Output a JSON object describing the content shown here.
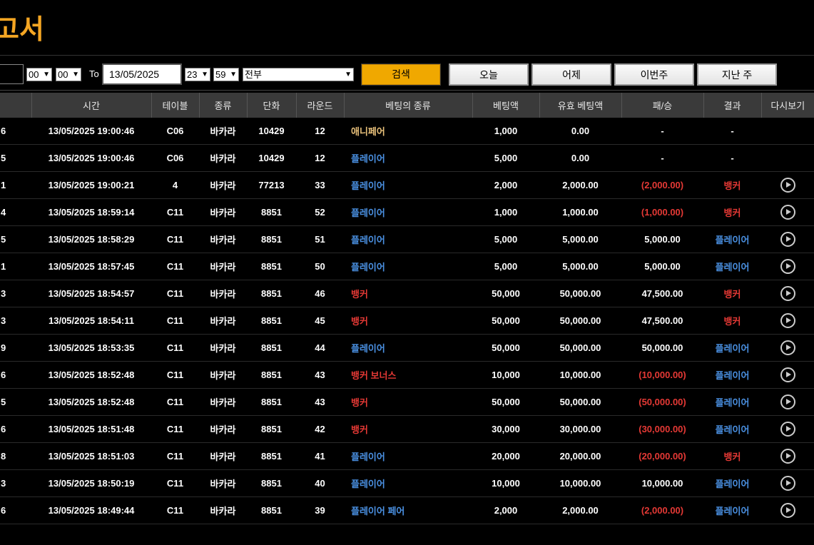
{
  "page_title": "고서",
  "filter": {
    "from_hour": "00",
    "from_minute": "00",
    "to_label": "To",
    "to_date": "13/05/2025",
    "to_hour": "23",
    "to_minute": "59",
    "category": "전부",
    "search_label": "검색",
    "quick": [
      "오늘",
      "어제",
      "이번주",
      "지난 주"
    ]
  },
  "table": {
    "columns": [
      "",
      "시간",
      "테이블",
      "종류",
      "단화",
      "라운드",
      "베팅의 종류",
      "베팅액",
      "유효 베팅액",
      "패/승",
      "결과",
      "다시보기"
    ],
    "rows": [
      {
        "id": "6",
        "time": "13/05/2025 19:00:46",
        "table": "C06",
        "game": "바카라",
        "shoe": "10429",
        "round": "12",
        "bet_type": "애니페어",
        "bet_color": "neutral",
        "amount": "1,000",
        "valid": "0.00",
        "winloss": "-",
        "wl_color": "white",
        "result": "-",
        "res_color": "white",
        "replay": false
      },
      {
        "id": "5",
        "time": "13/05/2025 19:00:46",
        "table": "C06",
        "game": "바카라",
        "shoe": "10429",
        "round": "12",
        "bet_type": "플레이어",
        "bet_color": "blue",
        "amount": "5,000",
        "valid": "0.00",
        "winloss": "-",
        "wl_color": "white",
        "result": "-",
        "res_color": "white",
        "replay": false
      },
      {
        "id": "1",
        "time": "13/05/2025 19:00:21",
        "table": "4",
        "game": "바카라",
        "shoe": "77213",
        "round": "33",
        "bet_type": "플레이어",
        "bet_color": "blue",
        "amount": "2,000",
        "valid": "2,000.00",
        "winloss": "(2,000.00)",
        "wl_color": "red",
        "result": "뱅커",
        "res_color": "red",
        "replay": true
      },
      {
        "id": "4",
        "time": "13/05/2025 18:59:14",
        "table": "C11",
        "game": "바카라",
        "shoe": "8851",
        "round": "52",
        "bet_type": "플레이어",
        "bet_color": "blue",
        "amount": "1,000",
        "valid": "1,000.00",
        "winloss": "(1,000.00)",
        "wl_color": "red",
        "result": "뱅커",
        "res_color": "red",
        "replay": true
      },
      {
        "id": "5",
        "time": "13/05/2025 18:58:29",
        "table": "C11",
        "game": "바카라",
        "shoe": "8851",
        "round": "51",
        "bet_type": "플레이어",
        "bet_color": "blue",
        "amount": "5,000",
        "valid": "5,000.00",
        "winloss": "5,000.00",
        "wl_color": "white",
        "result": "플레이어",
        "res_color": "blue",
        "replay": true
      },
      {
        "id": "1",
        "time": "13/05/2025 18:57:45",
        "table": "C11",
        "game": "바카라",
        "shoe": "8851",
        "round": "50",
        "bet_type": "플레이어",
        "bet_color": "blue",
        "amount": "5,000",
        "valid": "5,000.00",
        "winloss": "5,000.00",
        "wl_color": "white",
        "result": "플레이어",
        "res_color": "blue",
        "replay": true
      },
      {
        "id": "3",
        "time": "13/05/2025 18:54:57",
        "table": "C11",
        "game": "바카라",
        "shoe": "8851",
        "round": "46",
        "bet_type": "뱅커",
        "bet_color": "red",
        "amount": "50,000",
        "valid": "50,000.00",
        "winloss": "47,500.00",
        "wl_color": "white",
        "result": "뱅커",
        "res_color": "red",
        "replay": true
      },
      {
        "id": "3",
        "time": "13/05/2025 18:54:11",
        "table": "C11",
        "game": "바카라",
        "shoe": "8851",
        "round": "45",
        "bet_type": "뱅커",
        "bet_color": "red",
        "amount": "50,000",
        "valid": "50,000.00",
        "winloss": "47,500.00",
        "wl_color": "white",
        "result": "뱅커",
        "res_color": "red",
        "replay": true
      },
      {
        "id": "9",
        "time": "13/05/2025 18:53:35",
        "table": "C11",
        "game": "바카라",
        "shoe": "8851",
        "round": "44",
        "bet_type": "플레이어",
        "bet_color": "blue",
        "amount": "50,000",
        "valid": "50,000.00",
        "winloss": "50,000.00",
        "wl_color": "white",
        "result": "플레이어",
        "res_color": "blue",
        "replay": true
      },
      {
        "id": "6",
        "time": "13/05/2025 18:52:48",
        "table": "C11",
        "game": "바카라",
        "shoe": "8851",
        "round": "43",
        "bet_type": "뱅커 보너스",
        "bet_color": "red",
        "amount": "10,000",
        "valid": "10,000.00",
        "winloss": "(10,000.00)",
        "wl_color": "red",
        "result": "플레이어",
        "res_color": "blue",
        "replay": true
      },
      {
        "id": "5",
        "time": "13/05/2025 18:52:48",
        "table": "C11",
        "game": "바카라",
        "shoe": "8851",
        "round": "43",
        "bet_type": "뱅커",
        "bet_color": "red",
        "amount": "50,000",
        "valid": "50,000.00",
        "winloss": "(50,000.00)",
        "wl_color": "red",
        "result": "플레이어",
        "res_color": "blue",
        "replay": true
      },
      {
        "id": "6",
        "time": "13/05/2025 18:51:48",
        "table": "C11",
        "game": "바카라",
        "shoe": "8851",
        "round": "42",
        "bet_type": "뱅커",
        "bet_color": "red",
        "amount": "30,000",
        "valid": "30,000.00",
        "winloss": "(30,000.00)",
        "wl_color": "red",
        "result": "플레이어",
        "res_color": "blue",
        "replay": true
      },
      {
        "id": "8",
        "time": "13/05/2025 18:51:03",
        "table": "C11",
        "game": "바카라",
        "shoe": "8851",
        "round": "41",
        "bet_type": "플레이어",
        "bet_color": "blue",
        "amount": "20,000",
        "valid": "20,000.00",
        "winloss": "(20,000.00)",
        "wl_color": "red",
        "result": "뱅커",
        "res_color": "red",
        "replay": true
      },
      {
        "id": "3",
        "time": "13/05/2025 18:50:19",
        "table": "C11",
        "game": "바카라",
        "shoe": "8851",
        "round": "40",
        "bet_type": "플레이어",
        "bet_color": "blue",
        "amount": "10,000",
        "valid": "10,000.00",
        "winloss": "10,000.00",
        "wl_color": "white",
        "result": "플레이어",
        "res_color": "blue",
        "replay": true
      },
      {
        "id": "6",
        "time": "13/05/2025 18:49:44",
        "table": "C11",
        "game": "바카라",
        "shoe": "8851",
        "round": "39",
        "bet_type": "플레이어 페어",
        "bet_color": "blue",
        "amount": "2,000",
        "valid": "2,000.00",
        "winloss": "(2,000.00)",
        "wl_color": "red",
        "result": "플레이어",
        "res_color": "blue",
        "replay": true
      }
    ]
  },
  "colors": {
    "accent": "#f5a623",
    "blue": "#4a90e2",
    "red": "#e53935",
    "neutral": "#e8c07a",
    "header_bg": "#3a3a3a"
  }
}
